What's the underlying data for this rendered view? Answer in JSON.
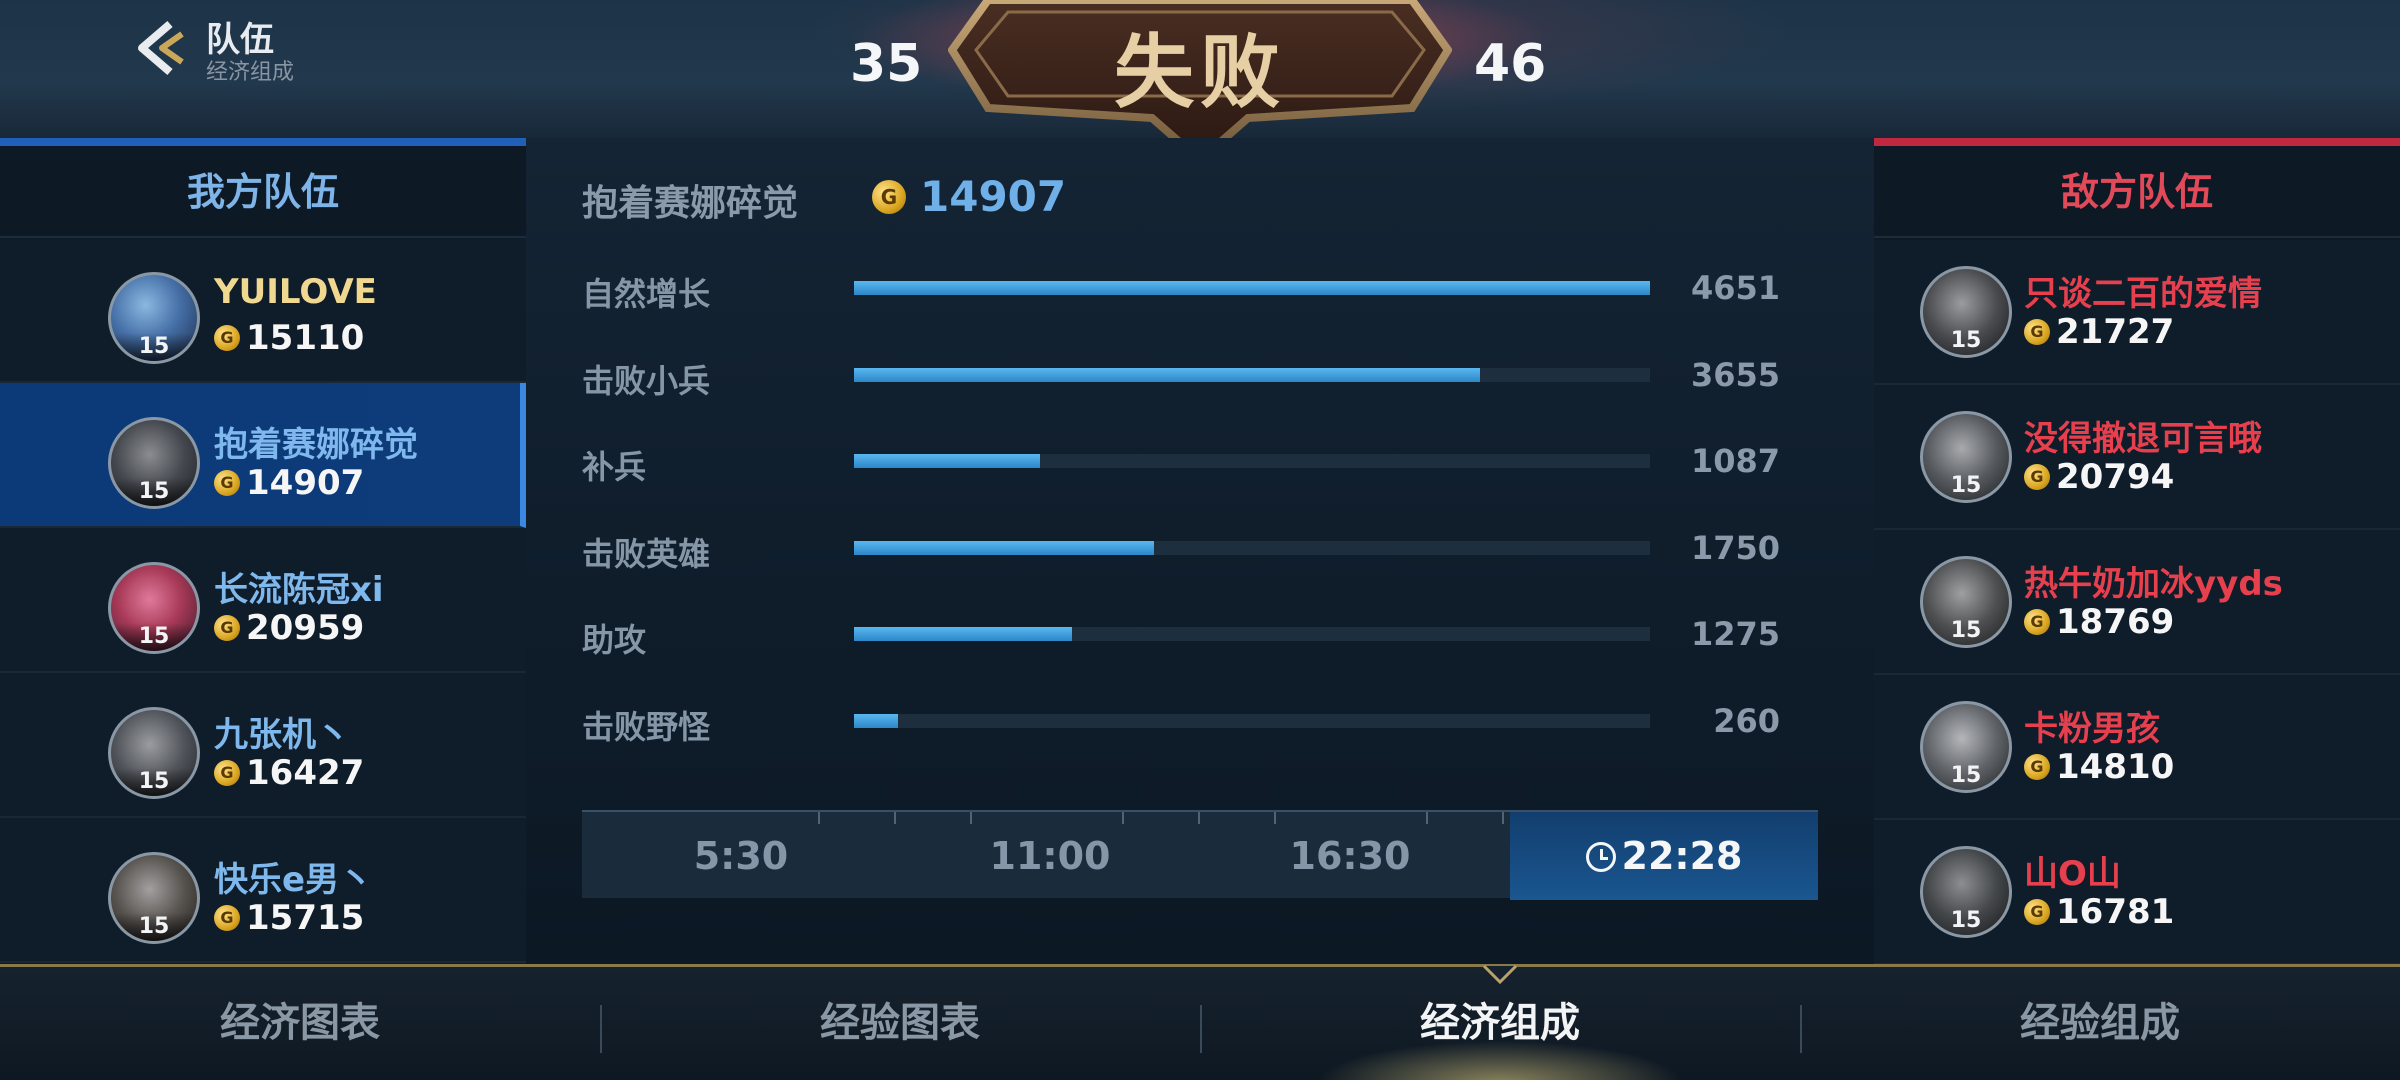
{
  "header": {
    "title": "队伍",
    "subtitle": "经济组成",
    "score_left": "35",
    "score_right": "46",
    "result": "失败"
  },
  "side_id": "40985507",
  "ally_team": {
    "title": "我方队伍",
    "players": [
      {
        "name": "YUILOVE",
        "gold": "15110",
        "level": "15"
      },
      {
        "name": "抱着赛娜碎觉",
        "gold": "14907",
        "level": "15"
      },
      {
        "name": "长流陈冠xi",
        "gold": "20959",
        "level": "15"
      },
      {
        "name": "九张机丶",
        "gold": "16427",
        "level": "15"
      },
      {
        "name": "快乐e男丶",
        "gold": "15715",
        "level": "15"
      }
    ]
  },
  "enemy_team": {
    "title": "敌方队伍",
    "players": [
      {
        "name": "只谈二百的爱情",
        "gold": "21727",
        "level": "15"
      },
      {
        "name": "没得撤退可言哦",
        "gold": "20794",
        "level": "15"
      },
      {
        "name": "热牛奶加冰yyds",
        "gold": "18769",
        "level": "15"
      },
      {
        "name": "卡粉男孩",
        "gold": "14810",
        "level": "15"
      },
      {
        "name": "山O山",
        "gold": "16781",
        "level": "15"
      }
    ]
  },
  "selected": {
    "name": "抱着赛娜碎觉",
    "gold": "14907",
    "coin_symbol": "G"
  },
  "breakdown": [
    {
      "label": "自然增长",
      "value": "4651"
    },
    {
      "label": "击败小兵",
      "value": "3655"
    },
    {
      "label": "补兵",
      "value": "1087"
    },
    {
      "label": "击败英雄",
      "value": "1750"
    },
    {
      "label": "助攻",
      "value": "1275"
    },
    {
      "label": "击败野怪",
      "value": "260"
    }
  ],
  "timeline": {
    "points": [
      "5:30",
      "11:00",
      "16:30",
      "22:28"
    ],
    "active_index": 3
  },
  "tabs": [
    {
      "label": "经济图表"
    },
    {
      "label": "经验图表"
    },
    {
      "label": "经济组成"
    },
    {
      "label": "经验组成"
    }
  ],
  "colors": {
    "ally": "#7fb8ec",
    "enemy": "#e6404e",
    "bar": "#3a9ee0",
    "gold": "#d9a520"
  }
}
